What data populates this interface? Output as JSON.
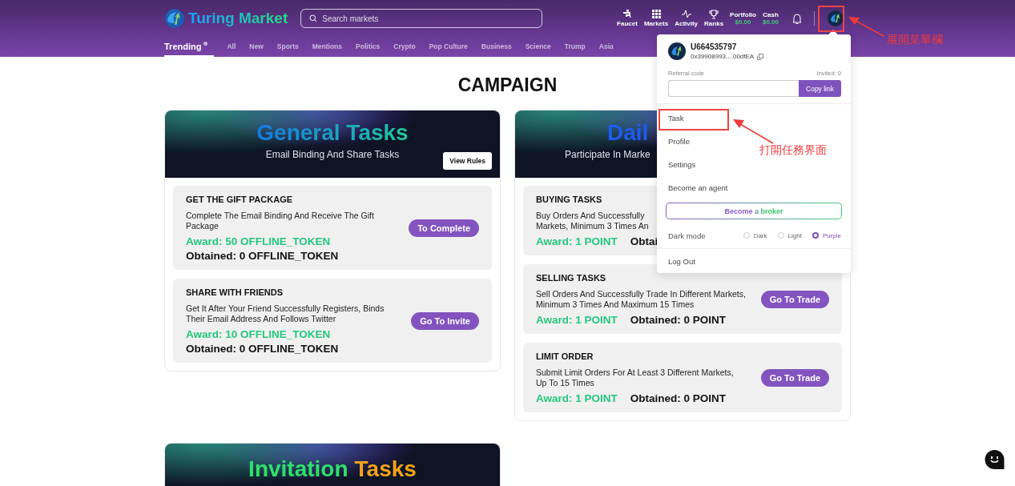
{
  "header": {
    "brand": "Turing Market",
    "search": {
      "placeholder": "Search markets"
    },
    "actions": [
      {
        "kind": "faucet",
        "label": "Faucet"
      },
      {
        "kind": "markets",
        "label": "Markets"
      },
      {
        "kind": "activity",
        "label": "Activity"
      },
      {
        "kind": "ranks",
        "label": "Ranks"
      }
    ],
    "balances": [
      {
        "label": "Portfolio",
        "value": "$0.00"
      },
      {
        "label": "Cash",
        "value": "$0.00"
      }
    ],
    "nav": [
      {
        "label": "Trending",
        "selected": true
      },
      {
        "label": "All",
        "selected": false
      },
      {
        "label": "New",
        "selected": false
      },
      {
        "label": "Sports",
        "selected": false
      },
      {
        "label": "Mentions",
        "selected": false
      },
      {
        "label": "Politics",
        "selected": false
      },
      {
        "label": "Crypto",
        "selected": false
      },
      {
        "label": "Pop Culture",
        "selected": false
      },
      {
        "label": "Business",
        "selected": false
      },
      {
        "label": "Science",
        "selected": false
      },
      {
        "label": "Trump",
        "selected": false
      },
      {
        "label": "Asia",
        "selected": false
      }
    ]
  },
  "page_title": "CAMPAIGN",
  "cards": [
    {
      "kind": "general",
      "banner": {
        "title_parts": [
          {
            "text": "General Tasks"
          }
        ],
        "subtitle": "Email Binding And Share Tasks",
        "rules_button": "View Rules"
      },
      "tasks": [
        {
          "title": "GET THE GIFT PACKAGE",
          "description": "Complete The Email Binding And Receive The Gift Package",
          "award": "Award: 50 OFFLINE_TOKEN",
          "obtained": "Obtained: 0 OFFLINE_TOKEN",
          "button": "To Complete"
        },
        {
          "title": "SHARE WITH FRIENDS",
          "description": "Get It After Your Friend Successfully Registers, Binds Their Email Address And Follows Twitter",
          "award": "Award: 10 OFFLINE_TOKEN",
          "obtained": "Obtained: 0 OFFLINE_TOKEN",
          "button": "Go To Invite"
        }
      ]
    },
    {
      "kind": "daily",
      "banner": {
        "title_parts": [
          {
            "text": "Dail"
          }
        ],
        "subtitle": "Participate In Marke"
      },
      "tasks": [
        {
          "title": "BUYING TASKS",
          "description": "Buy Orders And Successfully\nMarkets, Minimum 3 Times An",
          "award": "Award: 1 POINT",
          "obtained": "Obtai"
        },
        {
          "title": "SELLING TASKS",
          "description": "Sell Orders And Successfully Trade In Different Markets, Minimum 3 Times And Maximum 15 Times",
          "award": "Award: 1 POINT",
          "obtained": "Obtained: 0 POINT",
          "button": "Go To Trade"
        },
        {
          "title": "LIMIT ORDER",
          "description": "Submit Limit Orders For At Least 3 Different Markets, Up To 15 Times",
          "award": "Award: 1 POINT",
          "obtained": "Obtained: 0 POINT",
          "button": "Go To Trade"
        }
      ]
    },
    {
      "kind": "invitation",
      "banner": {
        "title_parts": [
          {
            "text": "Invitation",
            "color": "#2ee06a"
          },
          {
            "text": "Tasks",
            "color": "#f2a216"
          }
        ]
      }
    }
  ],
  "account_menu": {
    "username": "U664535797",
    "address": "0x39908993....00dfEA",
    "referral_label": "Referral code",
    "invited": "Invited: 0",
    "copy_button": "Copy link",
    "items": [
      "Task",
      "Profile",
      "Settings",
      "Become an agent"
    ],
    "broker_button": "Become a broker",
    "theme_label": "Dark mode",
    "themes": [
      {
        "label": "Dark",
        "selected": false
      },
      {
        "label": "Light",
        "selected": false
      },
      {
        "label": "Purple",
        "selected": true
      }
    ],
    "logout": "Log Out"
  },
  "annotations": [
    {
      "text": "展開菜單欄"
    },
    {
      "text": "打開任務界面"
    }
  ]
}
